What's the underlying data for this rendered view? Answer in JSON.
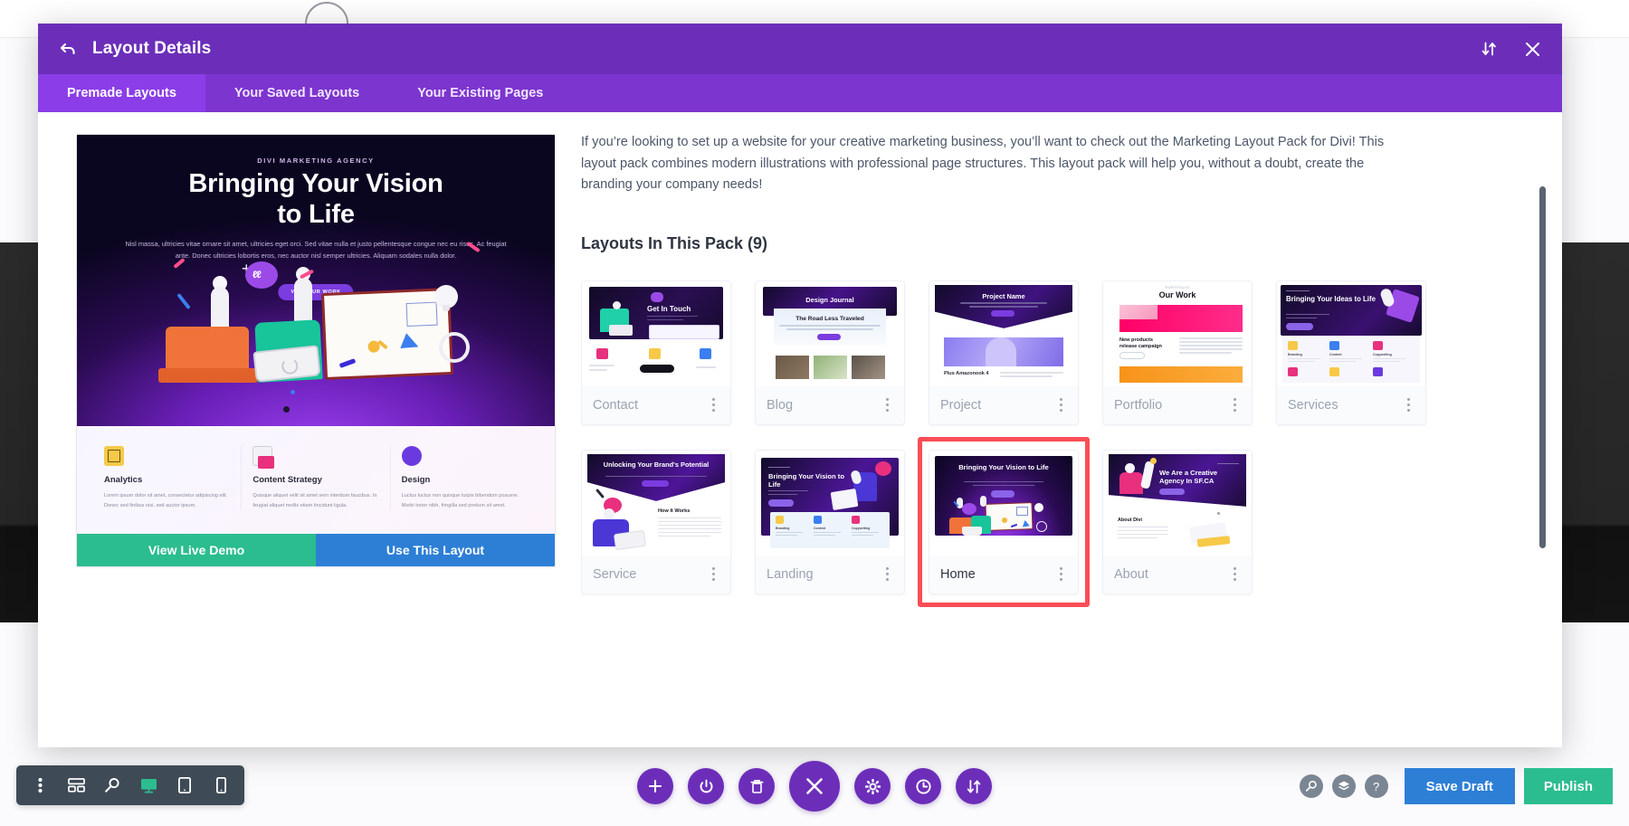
{
  "modal": {
    "title": "Layout Details",
    "back_icon": "back-arrow-icon",
    "sort_icon": "sort-updown-icon",
    "close_icon": "close-x-icon",
    "tabs": [
      {
        "label": "Premade Layouts",
        "active": true
      },
      {
        "label": "Your Saved Layouts",
        "active": false
      },
      {
        "label": "Your Existing Pages",
        "active": false
      }
    ]
  },
  "preview": {
    "hero": {
      "kicker": "DIVI MARKETING AGENCY",
      "heading_line1": "Bringing Your Vision",
      "heading_line2": "to Life",
      "paragraph": "Nisl massa, ultricies vitae ornare sit amet, ultricies eget orci. Sed vitae nulla et justo pellentesque congue nec eu risus. Ac feugiat ante. Donec ultricies lobortis eros, nec auctor nisl semper ultricies. Aliquam sodales nulla dolor.",
      "cta": "VIEW OUR WORK"
    },
    "features": [
      {
        "icon": "chart-icon",
        "title": "Analytics",
        "desc": "Lorem ipsum dolor sit amet, consectetur adipiscing elit. Donec sed finibus nisi, sed auctor ipsum."
      },
      {
        "icon": "document-icon",
        "title": "Content Strategy",
        "desc": "Quisque aliquet velit sit amet sem interdum faucibus. In feugiat aliquet mollis etiam tincidunt ligula."
      },
      {
        "icon": "palette-icon",
        "title": "Design",
        "desc": "Luctus luctus non quisque turpis bibendum posuere. Morbi tortor nibh, fringilla sed pretium sit amet."
      }
    ],
    "actions": {
      "demo": "View Live Demo",
      "use": "Use This Layout"
    }
  },
  "details": {
    "description": "If you’re looking to set up a website for your creative marketing business, you’ll want to check out the Marketing Layout Pack for Divi! This layout pack combines modern illustrations with professional page structures. This layout pack will help you, without a doubt, create the branding your company needs!",
    "pack_heading": "Layouts In This Pack (9)",
    "layouts": [
      {
        "name": "Contact",
        "thumb_title": "Get In Touch",
        "selected": false,
        "style": "contact"
      },
      {
        "name": "Blog",
        "thumb_title": "Design Journal",
        "selected": false,
        "style": "blog",
        "sub_title": "The Road Less Traveled"
      },
      {
        "name": "Project",
        "thumb_title": "Project Name",
        "selected": false,
        "style": "project"
      },
      {
        "name": "Portfolio",
        "thumb_title": "Our Work",
        "selected": false,
        "style": "portfolio",
        "sub_title": "New products release campaign"
      },
      {
        "name": "Services",
        "thumb_title": "Bringing Your Ideas to Life",
        "selected": false,
        "style": "services"
      },
      {
        "name": "Service",
        "thumb_title": "Unlocking Your Brand's Potential",
        "selected": false,
        "style": "service",
        "sub_title": "How It Works"
      },
      {
        "name": "Landing",
        "thumb_title": "Bringing Your Vision to Life",
        "selected": false,
        "style": "landing"
      },
      {
        "name": "Home",
        "thumb_title": "Bringing Your Vision to Life",
        "selected": true,
        "style": "home"
      },
      {
        "name": "About",
        "thumb_title": "We Are a Creative Agency In SF.CA",
        "selected": false,
        "style": "about",
        "sub_title": "About Divi"
      }
    ],
    "selection_color": "#fa4d56"
  },
  "bottom_bar": {
    "left_tools": [
      {
        "icon": "kebab-menu-icon",
        "active": false
      },
      {
        "icon": "wireframe-icon",
        "active": false
      },
      {
        "icon": "zoom-out-icon",
        "active": false
      },
      {
        "icon": "desktop-icon",
        "active": true
      },
      {
        "icon": "tablet-icon",
        "active": false
      },
      {
        "icon": "phone-icon",
        "active": false
      }
    ],
    "center_buttons": [
      {
        "icon": "plus-icon",
        "big": false
      },
      {
        "icon": "power-icon",
        "big": false
      },
      {
        "icon": "trash-icon",
        "big": false
      },
      {
        "icon": "close-x-icon",
        "big": true
      },
      {
        "icon": "gear-icon",
        "big": false
      },
      {
        "icon": "history-icon",
        "big": false
      },
      {
        "icon": "sort-updown-icon",
        "big": false
      }
    ],
    "right_tools": [
      {
        "icon": "search-icon"
      },
      {
        "icon": "layers-icon"
      },
      {
        "icon": "help-icon"
      }
    ],
    "save_draft_label": "Save Draft",
    "publish_label": "Publish",
    "accent_purple": "#6c2eb9",
    "accent_blue": "#2d7fd6",
    "accent_green": "#2bbd8f"
  }
}
